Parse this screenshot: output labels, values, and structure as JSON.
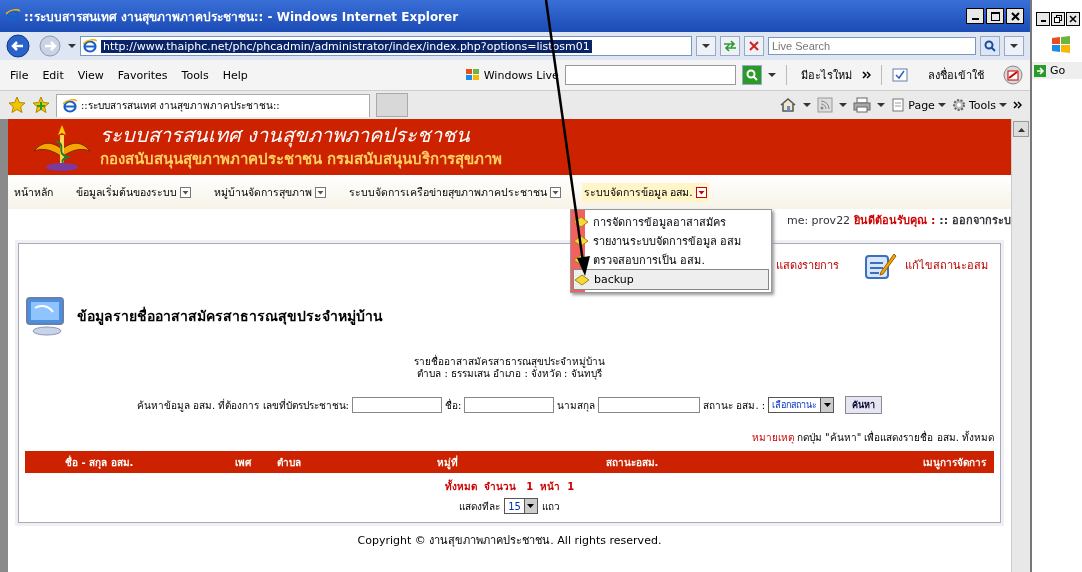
{
  "window": {
    "title": "::ระบบสารสนเทศ งานสุขภาพภาคประชาชน:: - Windows Internet Explorer"
  },
  "address_bar": {
    "url": "http://www.thaiphc.net/phc/phcadmin/administrator/index/index.php?options=listosm01",
    "search_placeholder": "Live Search"
  },
  "menu_bar": [
    "File",
    "Edit",
    "View",
    "Favorites",
    "Tools",
    "Help"
  ],
  "live_toolbar": {
    "brand": "Windows Live",
    "whats_new": "มีอะไรใหม่",
    "sign_in": "ลงชื่อเข้าใช้"
  },
  "tabs": [
    {
      "label": "::ระบบสารสนเทศ งานสุขภาพภาคประชาชน::",
      "selected": true
    }
  ],
  "command_bar": [
    "Page",
    "Tools"
  ],
  "side_window": {
    "go_button": "Go"
  },
  "banner": {
    "title": "ระบบสารสนเทศ งานสุขภาพภาคประชาชน",
    "subtitle": "กองสนับสนุนสุขภาพภาคประชาชน กรมสนับสนุนบริการสุขภาพ"
  },
  "nav": [
    {
      "label": "หน้าหลัก",
      "has_dropdown": false,
      "expanded": false
    },
    {
      "label": "ข้อมูลเริ่มต้นของระบบ",
      "has_dropdown": true,
      "expanded": false
    },
    {
      "label": "หมู่บ้านจัดการสุขภาพ",
      "has_dropdown": true,
      "expanded": false
    },
    {
      "label": "ระบบจัดการเครือข่ายสุขภาพภาคประชาชน",
      "has_dropdown": true,
      "expanded": false
    },
    {
      "label": "ระบบจัดการข้อมูล อสม.",
      "has_dropdown": true,
      "expanded": true
    }
  ],
  "dropdown": [
    {
      "label": "การจัดการข้อมูลอาสาสมัคร",
      "selected": false
    },
    {
      "label": "รายงานระบบจัดการข้อมูล อสม",
      "selected": false
    },
    {
      "label": "ตรวจสอบการเป็น อสม.",
      "selected": false
    },
    {
      "label": "backup",
      "selected": true
    }
  ],
  "user_line": {
    "username": "me: prov22",
    "welcome": "ยินดีต้อนรับคุณ :",
    "logout": ":: ออกจากระบ"
  },
  "actions": [
    "แสดงรายการ",
    "แก้ไขสถานะอสม"
  ],
  "heading": "ข้อมูลรายชื่ออาสาสมัครสาธารณสุขประจำหมู่บ้าน",
  "subheading": [
    "รายชื่ออาสาสมัครสาธารณสุขประจำหมู่บ้าน",
    "ตำบล : ธรรมเสน อำเภอ : จังหวัด : จันทบุรี"
  ],
  "search": {
    "intro": "ค้นหาข้อมูล อสม. ที่ต้องการ เลขที่บัตรประชาชน:",
    "first_name": "ชื่อ:",
    "last_name": "นามสกุล",
    "status_label": "สถานะ อสม. :",
    "status_value": "เลือกสถานะ",
    "button": "ค้นหา"
  },
  "note": {
    "label": "หมายเหตุ",
    "text": "กดปุ่ม \"ค้นหา\" เพื่อแสดงรายชื่อ อสม. ทั้งหมด"
  },
  "table": {
    "columns": [
      "ชื่อ - สกุล อสม.",
      "เพศ",
      "ตำบล",
      "หมู่ที่",
      "สถานะอสม.",
      "เมนูการจัดการ"
    ]
  },
  "summary": {
    "total_label": "ทั้งหมด",
    "count_label": "จำนวน",
    "count": "1",
    "page_label": "หน้า",
    "page": "1"
  },
  "page_size": {
    "label": "แสดงทีละ",
    "value": "15",
    "unit": "แถว"
  },
  "footer": "Copyright © งานสุขภาพภาคประชาชน. All rights reserved."
}
